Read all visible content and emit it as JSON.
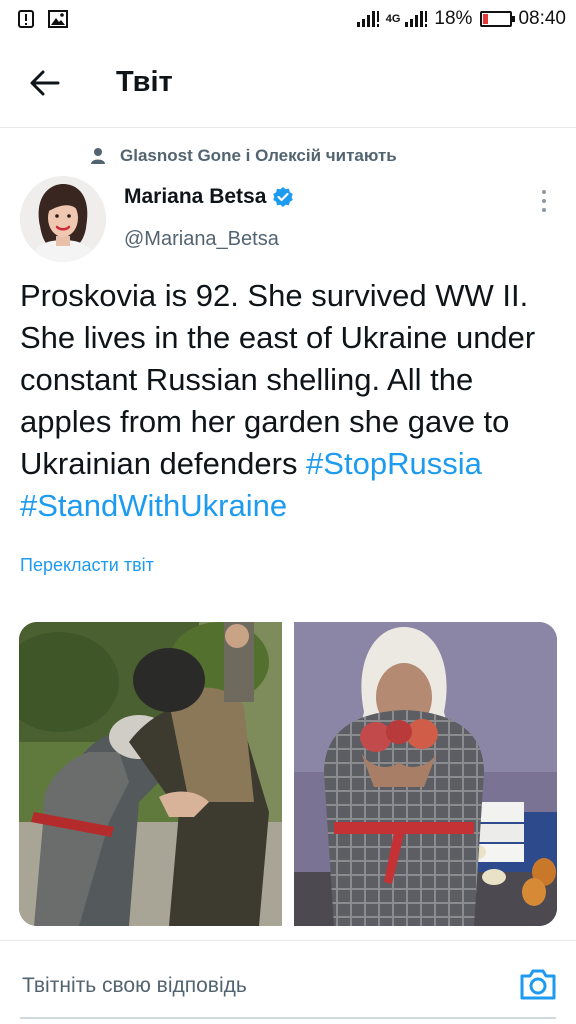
{
  "status_bar": {
    "network": "4G",
    "battery_percent": "18%",
    "battery_level": 0.18,
    "time": "08:40"
  },
  "header": {
    "title": "Твіт"
  },
  "social_context": {
    "text": "Glasnost Gone і Олексій читають"
  },
  "tweet": {
    "author_name": "Mariana Betsa",
    "handle": "@Mariana_Betsa",
    "verified": true,
    "text": "Proskovia is 92. She survived WW II. She lives in the east of Ukraine under constant Russian shelling. All the apples from her garden she gave to Ukrainian defenders ",
    "hashtags": [
      "#StopRussia",
      "#StandWithUkraine"
    ],
    "translate_label": "Перекласти твіт"
  },
  "reply": {
    "placeholder": "Твітніть свою відповідь"
  },
  "colors": {
    "accent": "#1d9bf0",
    "secondary_text": "#536471",
    "primary_text": "#0f1419"
  }
}
